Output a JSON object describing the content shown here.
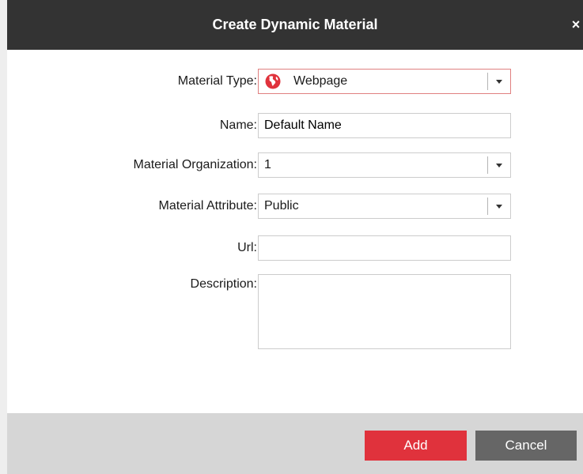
{
  "dialog": {
    "title": "Create Dynamic Material",
    "close_glyph": "×"
  },
  "form": {
    "material_type": {
      "label": "Material Type:",
      "value": "Webpage",
      "icon": "globe-icon",
      "accent_color": "#e0323c"
    },
    "name": {
      "label": "Name:",
      "value": "Default Name"
    },
    "material_organization": {
      "label": "Material Organization:",
      "value": "1"
    },
    "material_attribute": {
      "label": "Material Attribute:",
      "value": "Public"
    },
    "url": {
      "label": "Url:",
      "value": ""
    },
    "description": {
      "label": "Description:",
      "value": ""
    }
  },
  "footer": {
    "add_label": "Add",
    "cancel_label": "Cancel",
    "add_color": "#e0323c",
    "cancel_color": "#666666"
  }
}
